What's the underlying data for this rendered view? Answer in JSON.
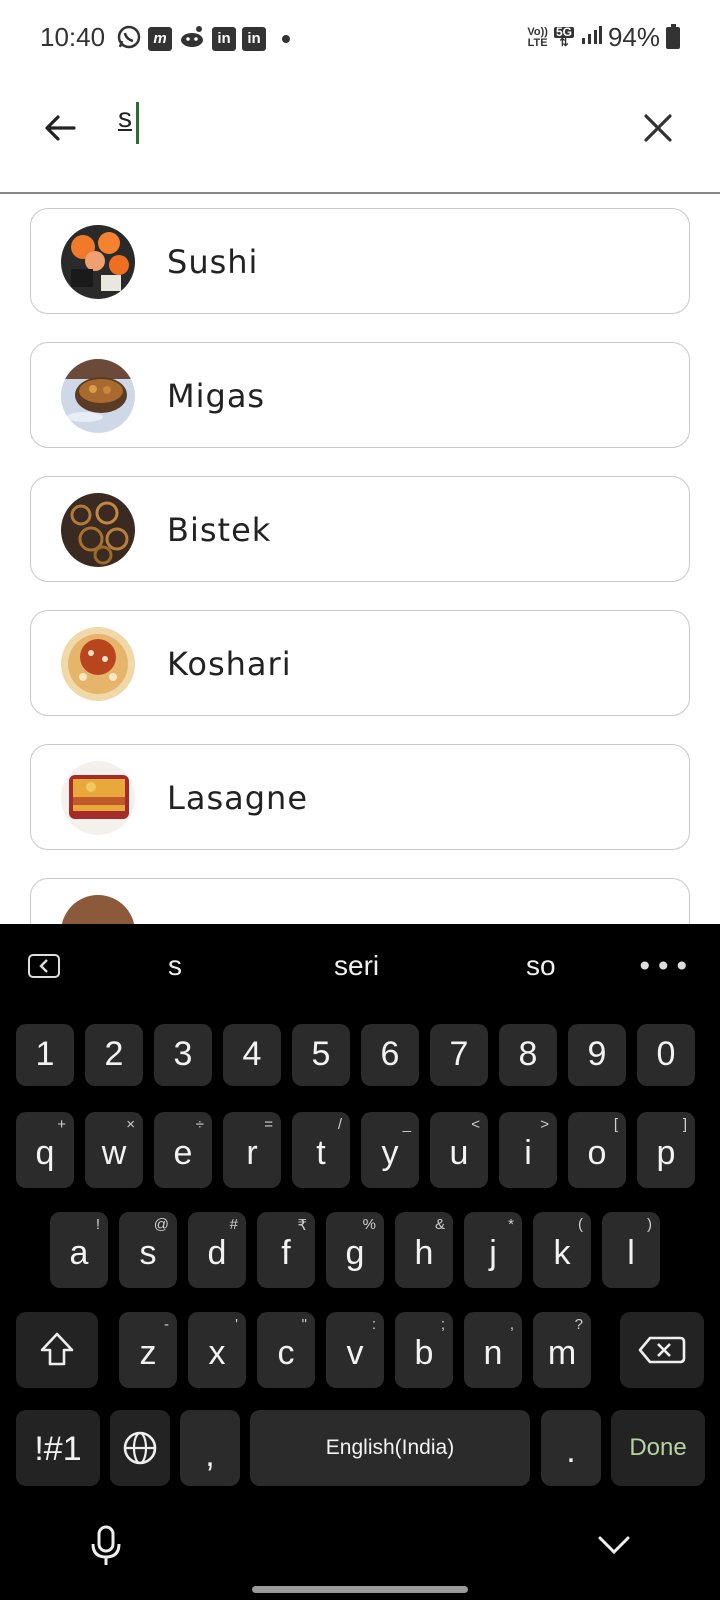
{
  "status_bar": {
    "time": "10:40",
    "network_label_top": "Vo))",
    "network_label_bottom": "LTE",
    "net_type": "5G",
    "battery": "94%",
    "notification_icons": [
      "whatsapp-icon",
      "myntra-icon",
      "reddit-icon",
      "linkedin-icon",
      "linkedin-icon"
    ]
  },
  "search": {
    "query": "s"
  },
  "results": [
    {
      "label": "Sushi",
      "icon": "sushi-image"
    },
    {
      "label": "Migas",
      "icon": "migas-image"
    },
    {
      "label": "Bistek",
      "icon": "bistek-image"
    },
    {
      "label": "Koshari",
      "icon": "koshari-image"
    },
    {
      "label": "Lasagne",
      "icon": "lasagne-image"
    }
  ],
  "keyboard": {
    "suggestions": [
      "s",
      "seri",
      "so"
    ],
    "row_numbers": [
      "1",
      "2",
      "3",
      "4",
      "5",
      "6",
      "7",
      "8",
      "9",
      "0"
    ],
    "row1": [
      {
        "k": "q",
        "h": "+"
      },
      {
        "k": "w",
        "h": "×"
      },
      {
        "k": "e",
        "h": "÷"
      },
      {
        "k": "r",
        "h": "="
      },
      {
        "k": "t",
        "h": "/"
      },
      {
        "k": "y",
        "h": "_"
      },
      {
        "k": "u",
        "h": "<"
      },
      {
        "k": "i",
        "h": ">"
      },
      {
        "k": "o",
        "h": "["
      },
      {
        "k": "p",
        "h": "]"
      }
    ],
    "row2": [
      {
        "k": "a",
        "h": "!"
      },
      {
        "k": "s",
        "h": "@"
      },
      {
        "k": "d",
        "h": "#"
      },
      {
        "k": "f",
        "h": "₹"
      },
      {
        "k": "g",
        "h": "%"
      },
      {
        "k": "h",
        "h": "&"
      },
      {
        "k": "j",
        "h": "*"
      },
      {
        "k": "k",
        "h": "("
      },
      {
        "k": "l",
        "h": ")"
      }
    ],
    "row3": [
      {
        "k": "z",
        "h": "-"
      },
      {
        "k": "x",
        "h": "'"
      },
      {
        "k": "c",
        "h": "\""
      },
      {
        "k": "v",
        "h": ":"
      },
      {
        "k": "b",
        "h": ";"
      },
      {
        "k": "n",
        "h": ","
      },
      {
        "k": "m",
        "h": "?"
      }
    ],
    "symbols_label": "!#1",
    "comma": ",",
    "space_label": "English(India)",
    "period": ".",
    "done_label": "Done"
  },
  "colors": {
    "cursor": "#2e6b2e",
    "done_text": "#b8d2a0",
    "key_bg": "#2b2b2b"
  }
}
